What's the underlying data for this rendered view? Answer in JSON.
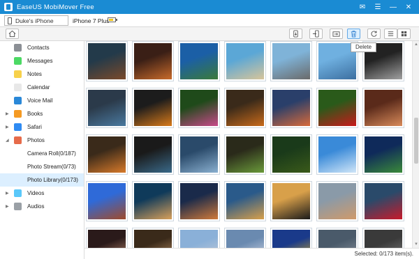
{
  "app": {
    "title": "EaseUS MobiMover Free"
  },
  "window_controls": [
    {
      "name": "feedback-icon",
      "glyph": "✉"
    },
    {
      "name": "menu-icon",
      "glyph": "☰"
    },
    {
      "name": "minimize-icon",
      "glyph": "—"
    },
    {
      "name": "close-icon",
      "glyph": "✕"
    }
  ],
  "device": {
    "name": "Duke's iPhone",
    "model": "iPhone 7 Plus",
    "battery_level": 0.75
  },
  "toolbar": {
    "tooltip": "Delete",
    "buttons": [
      {
        "name": "home-button",
        "icon": "home-icon"
      },
      {
        "name": "transfer-to-computer-button",
        "icon": "transfer-to-computer-icon"
      },
      {
        "name": "transfer-to-device-button",
        "icon": "transfer-to-device-icon"
      },
      {
        "name": "import-button",
        "icon": "import-icon"
      },
      {
        "name": "delete-button",
        "icon": "trash-icon"
      },
      {
        "name": "refresh-button",
        "icon": "refresh-icon"
      },
      {
        "name": "list-view-button",
        "icon": "list-view-icon"
      },
      {
        "name": "grid-view-button",
        "icon": "grid-view-icon"
      }
    ]
  },
  "sidebar": {
    "items": [
      {
        "label": "Contacts",
        "icon": "contacts-icon",
        "color": "#8b8f95",
        "expander": ""
      },
      {
        "label": "Messages",
        "icon": "messages-icon",
        "color": "#4cd964",
        "expander": ""
      },
      {
        "label": "Notes",
        "icon": "notes-icon",
        "color": "#f7d14b",
        "expander": ""
      },
      {
        "label": "Calendar",
        "icon": "calendar-icon",
        "color": "#e8e8e8",
        "expander": ""
      },
      {
        "label": "Voice Mail",
        "icon": "voicemail-icon",
        "color": "#2a88d8",
        "expander": ""
      },
      {
        "label": "Books",
        "icon": "books-icon",
        "color": "#f59a23",
        "expander": "▶"
      },
      {
        "label": "Safari",
        "icon": "safari-icon",
        "color": "#2f8bf3",
        "expander": "▶"
      },
      {
        "label": "Photos",
        "icon": "photos-icon",
        "color": "#e66b4a",
        "expander": "◢"
      },
      {
        "label": "Camera Roll(0/187)",
        "icon": "",
        "color": "",
        "expander": "",
        "sub": true
      },
      {
        "label": "Photo Stream(0/73)",
        "icon": "",
        "color": "",
        "expander": "",
        "sub": true
      },
      {
        "label": "Photo Library(0/173)",
        "icon": "",
        "color": "",
        "expander": "",
        "sub": true,
        "selected": true
      },
      {
        "label": "Videos",
        "icon": "videos-icon",
        "color": "#5ac8fa",
        "expander": "▶"
      },
      {
        "label": "Audios",
        "icon": "audios-icon",
        "color": "#9aa0a6",
        "expander": "▶"
      }
    ]
  },
  "photos": [
    [
      "#233a4a",
      "#7b4a2a"
    ],
    [
      "#3a1f16",
      "#c86a2a"
    ],
    [
      "#1b5fa6",
      "#3a7a3a"
    ],
    [
      "#5ba7d6",
      "#d8c59a"
    ],
    [
      "#7fb3d8",
      "#6a6a6a"
    ],
    [
      "#6fb0e0",
      "#3c6fa0"
    ],
    [
      "#222222",
      "#a0a0a0"
    ],
    [
      "#2b3a4a",
      "#4a7aa0"
    ],
    [
      "#1c1c1c",
      "#d87a1a"
    ],
    [
      "#1f4a1a",
      "#c84a8a"
    ],
    [
      "#3a2a1a",
      "#c86a1a"
    ],
    [
      "#2a3f6a",
      "#d86a3a"
    ],
    [
      "#2a5a1a",
      "#c81a1a"
    ],
    [
      "#5a2a1a",
      "#d88a5a"
    ],
    [
      "#3a2a1a",
      "#d87a2a"
    ],
    [
      "#1a1a1a",
      "#3a6a8a"
    ],
    [
      "#2a4a6a",
      "#8ab0d0"
    ],
    [
      "#2a2a1a",
      "#6a9a3a"
    ],
    [
      "#1a3a1a",
      "#3a5a1a"
    ],
    [
      "#3a8ad8",
      "#d0e6f8"
    ],
    [
      "#0f2a5a",
      "#3a8a3a"
    ],
    [
      "#2f6ad8",
      "#a04a2a"
    ],
    [
      "#0f3a5a",
      "#d8a05a"
    ],
    [
      "#1a2a4a",
      "#d07a3a"
    ],
    [
      "#2a5a8a",
      "#d8a04a"
    ],
    [
      "#d8a04a",
      "#1a1a1a"
    ],
    [
      "#8a9aa8",
      "#d09a6a"
    ],
    [
      "#2a4a6a",
      "#c81a2a"
    ],
    [
      "#2a1a1a",
      "#d8a080"
    ],
    [
      "#3a2a1a",
      "#d0a070"
    ],
    [
      "#8ab0d8",
      "#d0d0d8"
    ],
    [
      "#6a8ab0",
      "#e8e8f0"
    ],
    [
      "#1a3a8a",
      "#f0c01a"
    ],
    [
      "#4a5a6a",
      "#9aa0a8"
    ],
    [
      "#3a3a3a",
      "#8a8a8a"
    ]
  ],
  "status": {
    "text": "Selected: 0/173 item(s)."
  }
}
